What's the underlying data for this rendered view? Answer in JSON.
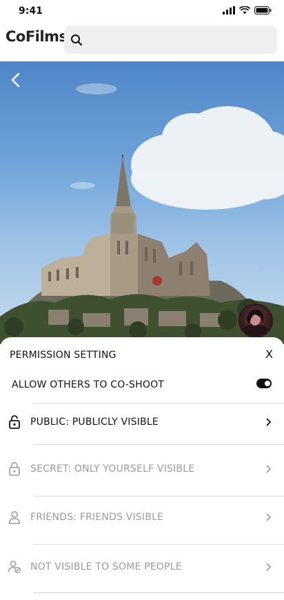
{
  "status_bar": {
    "time": "9:41"
  },
  "header": {
    "app_title": "CoFilms",
    "search_placeholder": ""
  },
  "hero": {
    "description_icon": "back-icon"
  },
  "sheet": {
    "title": "PERMISSION SETTING",
    "close_label": "X",
    "co_shoot": {
      "label": "ALLOW OTHERS TO CO-SHOOT",
      "enabled": true
    },
    "options": [
      {
        "label": "PUBLIC: PUBLICLY VISIBLE",
        "icon": "unlock-icon",
        "state": "active"
      },
      {
        "label": "SECRET: ONLY YOURSELF VISIBLE",
        "icon": "lock-icon",
        "state": "inactive"
      },
      {
        "label": "FRIENDS: FRIENDS VISIBLE",
        "icon": "person-icon",
        "state": "inactive"
      },
      {
        "label": "NOT VISIBLE TO SOME PEOPLE",
        "icon": "person-blocked-icon",
        "state": "inactive"
      }
    ]
  },
  "colors": {
    "active_text": "#111111",
    "inactive_text": "#9a9a9a",
    "divider": "#d9d9d9",
    "search_bg": "#efefef"
  }
}
